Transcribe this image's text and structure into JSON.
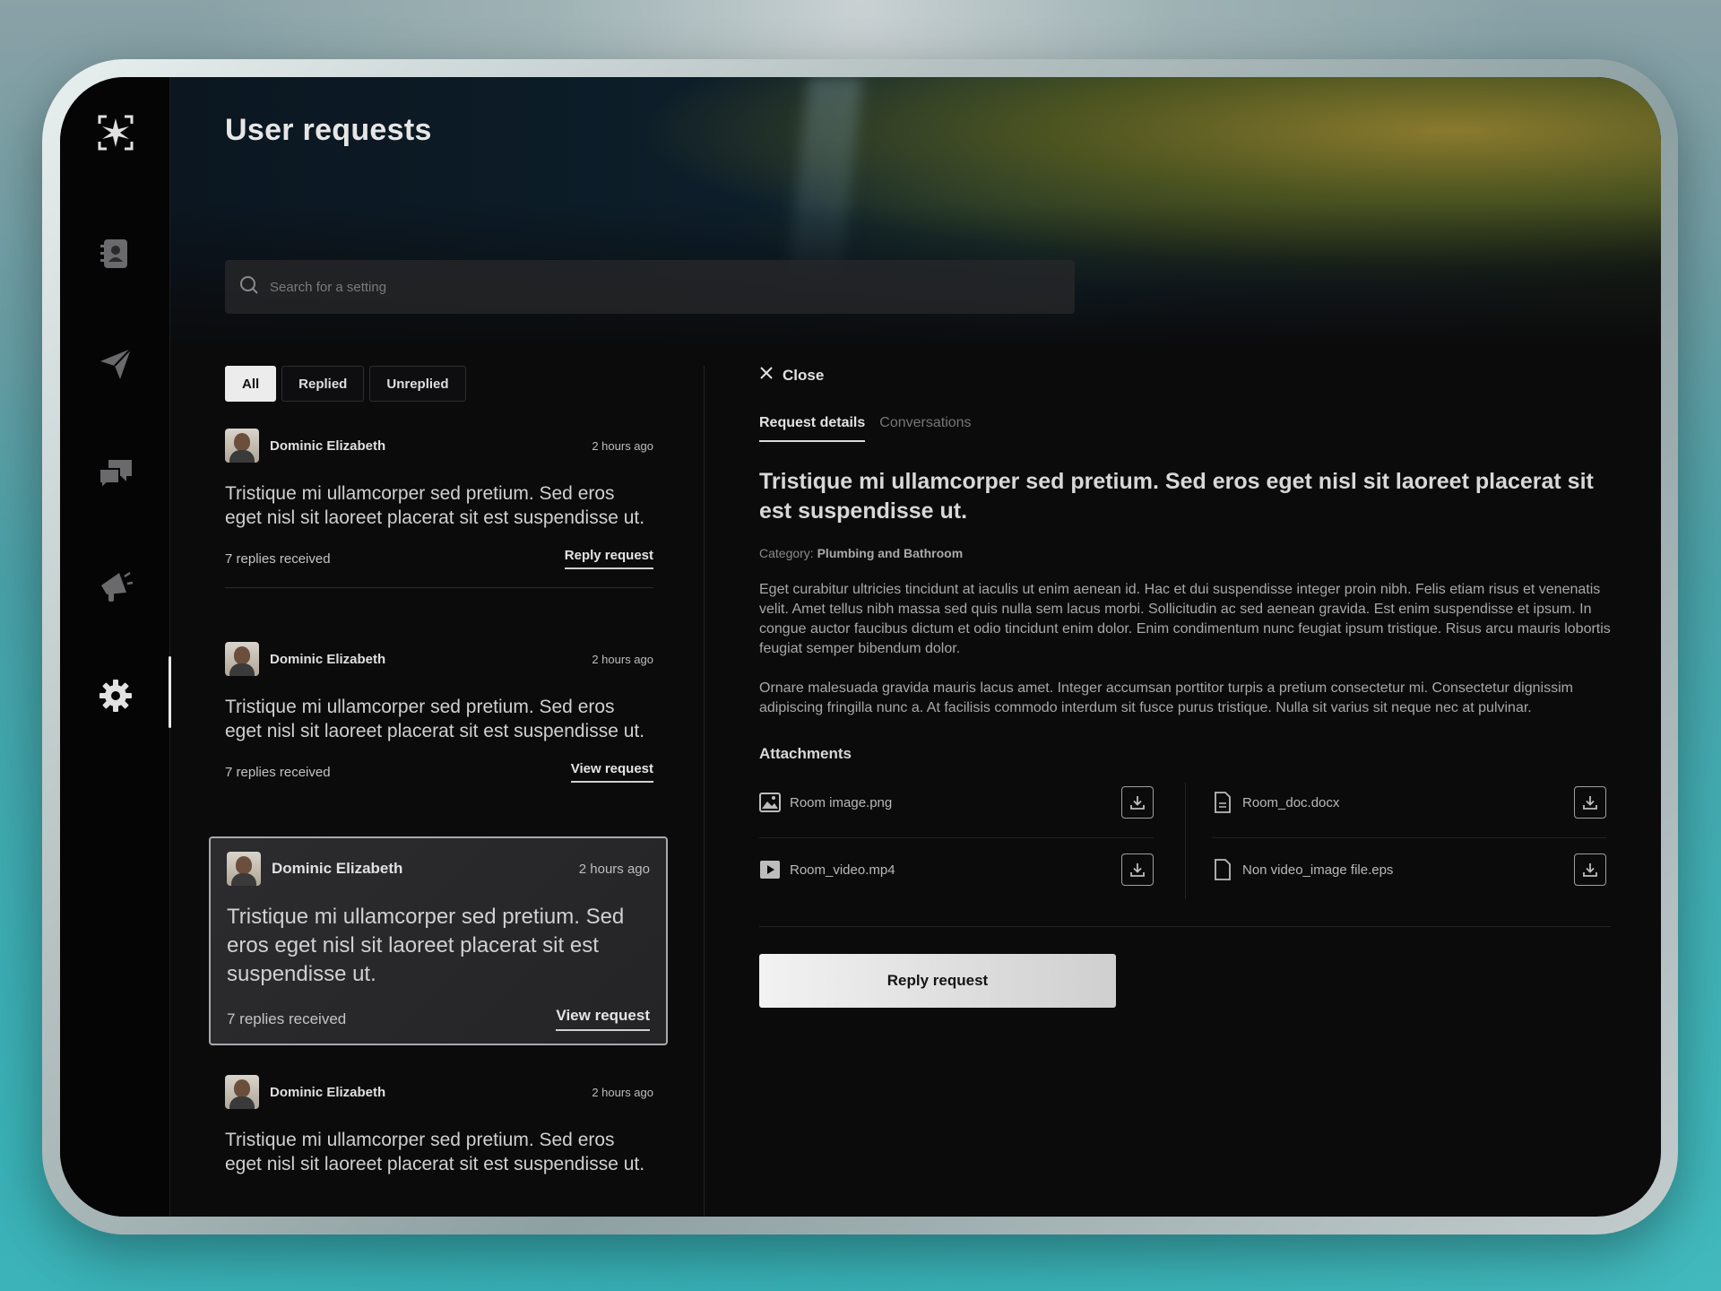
{
  "header": {
    "title": "User requests"
  },
  "search": {
    "placeholder": "Search for a setting"
  },
  "filters": {
    "all": "All",
    "replied": "Replied",
    "unreplied": "Unreplied"
  },
  "requests": [
    {
      "name": "Dominic Elizabeth",
      "time": "2 hours ago",
      "message": "Tristique mi ullamcorper sed pretium. Sed eros eget nisl sit laoreet placerat sit est suspendisse ut.",
      "replies": "7 replies received",
      "action": "Reply request"
    },
    {
      "name": "Dominic Elizabeth",
      "time": "2 hours ago",
      "message": "Tristique mi ullamcorper sed pretium. Sed eros eget nisl sit laoreet placerat sit est suspendisse ut.",
      "replies": "7 replies received",
      "action": "View request"
    },
    {
      "name": "Dominic Elizabeth",
      "time": "2 hours ago",
      "message": "Tristique mi ullamcorper sed pretium. Sed eros eget nisl sit laoreet placerat sit est suspendisse ut.",
      "replies": "7 replies received",
      "action": "View request"
    },
    {
      "name": "Dominic Elizabeth",
      "time": "2 hours ago",
      "message": "Tristique mi ullamcorper sed pretium. Sed eros eget nisl sit laoreet placerat sit est suspendisse ut."
    }
  ],
  "detail": {
    "close_label": "Close",
    "tabs": {
      "details": "Request details",
      "conversations": "Conversations"
    },
    "title": "Tristique mi ullamcorper sed pretium. Sed eros eget nisl sit laoreet placerat sit est suspendisse ut.",
    "category_label": "Category:",
    "category_value": "Plumbing and Bathroom",
    "paragraph1": "Eget curabitur ultricies tincidunt at iaculis ut enim aenean id. Hac et dui suspendisse integer proin nibh. Felis etiam risus et venenatis velit. Amet tellus nibh massa sed quis nulla sem lacus morbi. Sollicitudin ac sed aenean gravida. Est enim suspendisse et ipsum. In congue auctor faucibus dictum et odio tincidunt enim dolor. Enim condimentum nunc feugiat ipsum tristique. Risus arcu mauris lobortis feugiat semper bibendum dolor.",
    "paragraph2": "Ornare malesuada gravida mauris lacus amet. Integer accumsan porttitor turpis a pretium consectetur mi. Consectetur dignissim adipiscing fringilla nunc a. At facilisis commodo interdum sit fusce purus tristique. Nulla sit varius sit neque nec at pulvinar.",
    "attachments_title": "Attachments",
    "attachments": [
      {
        "name": "Room image.png",
        "icon": "image-file-icon"
      },
      {
        "name": "Room_doc.docx",
        "icon": "document-file-icon"
      },
      {
        "name": "Room_video.mp4",
        "icon": "video-file-icon"
      },
      {
        "name": "Non video_image file.eps",
        "icon": "file-icon"
      }
    ],
    "reply_label": "Reply request"
  },
  "nav": [
    "contacts-icon",
    "send-icon",
    "chat-icon",
    "megaphone-icon",
    "settings-icon"
  ]
}
